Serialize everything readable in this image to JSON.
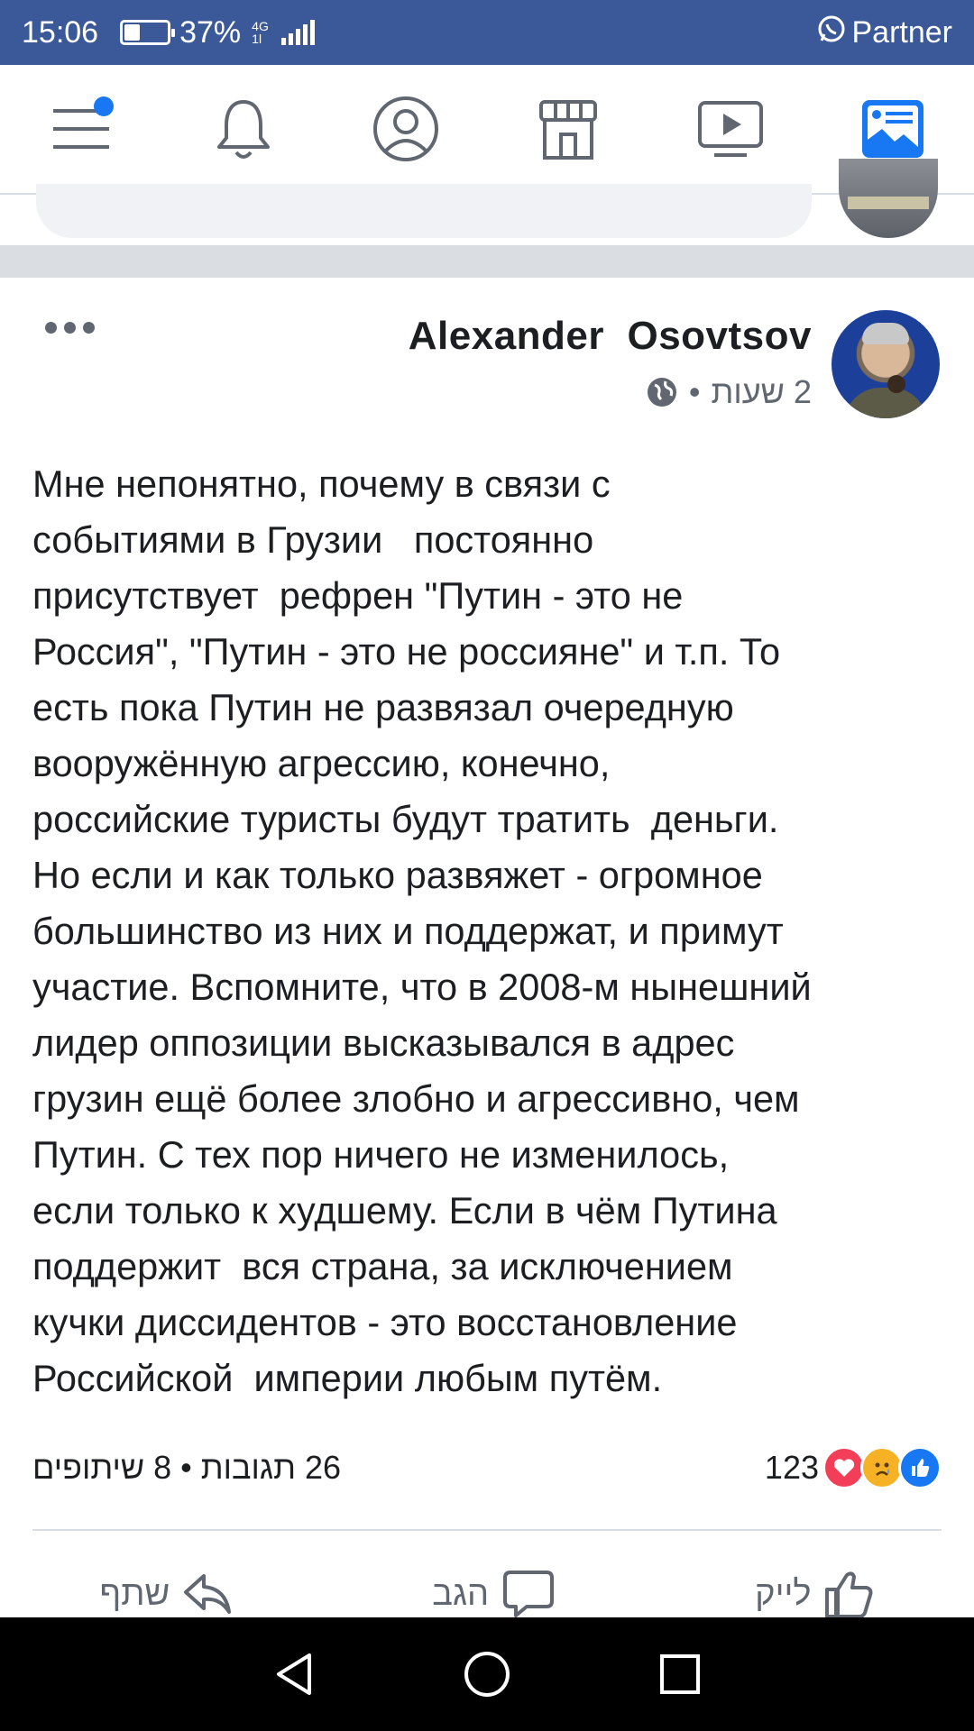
{
  "status_bar": {
    "time": "15:06",
    "battery": "37%",
    "battery_level": 0.37,
    "network_top": "4G",
    "network_bottom": "1l",
    "carrier": "Partner",
    "carrier_icon": "whatsapp-icon"
  },
  "top_nav": {
    "items": [
      {
        "icon": "menu-icon",
        "has_notification": true
      },
      {
        "icon": "bell-icon"
      },
      {
        "icon": "profile-icon"
      },
      {
        "icon": "marketplace-icon"
      },
      {
        "icon": "watch-icon"
      },
      {
        "icon": "news-feed-icon",
        "active": true
      }
    ]
  },
  "post": {
    "author": "Alexander  Osovtsov",
    "time": "2 שעות",
    "privacy_icon": "globe-icon",
    "text": "Мне непонятно, почему в связи с\nсобытиями в Грузии   постоянно\nприсутствует  рефрен \"Путин - это не\nРоссия\", \"Путин - это не россияне\" и т.п. То\nесть пока Путин не развязал очередную\nвооружённую агрессию, конечно,\nроссийские туристы будут тратить  деньги.\nНо если и как только развяжет - огромное\nбольшинство из них и поддержат, и примут\nучастие. Вспомните, что в 2008-м нынешний\nлидер оппозиции высказывался в адрес\nгрузин ещё более злобно и агрессивно, чем\nПутин. С тех пор ничего не изменилось,\nесли только к худшему. Если в чём Путина\nподдержит  вся страна, за исключением\nкучки диссидентов - это восстановление\nРоссийской  империи любым путём.",
    "stats": {
      "comments_shares": "26 תגובות • 8 שיתופים",
      "reactions_count": "123",
      "reaction_types": [
        "love",
        "sad",
        "like"
      ]
    },
    "actions": {
      "share": "שתף",
      "comment": "הגב",
      "like": "לייק"
    }
  },
  "colors": {
    "status_bar": "#3b5998",
    "accent": "#1877f2",
    "text": "#1c1e21",
    "secondary_text": "#606770",
    "divider": "#dadde1"
  }
}
